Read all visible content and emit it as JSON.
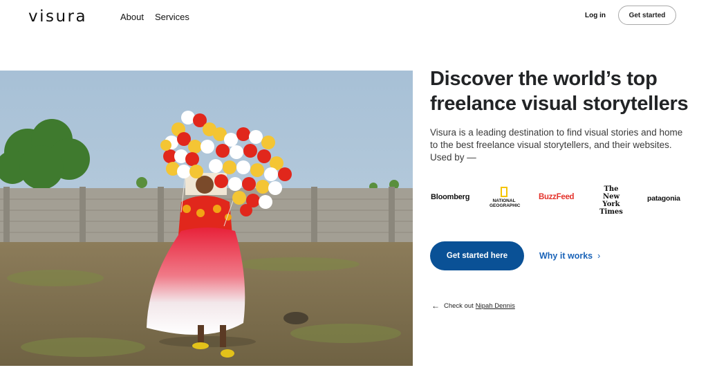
{
  "header": {
    "logo_text": "visura",
    "nav": [
      "About",
      "Services"
    ],
    "login_label": "Log in",
    "cta_label": "Get started"
  },
  "hero": {
    "headline_line1": "Discover the world’s top",
    "headline_line2": "freelance visual storytellers",
    "description": "Visura is a leading destination to find visual stories and home to the best freelance visual storytellers, and their websites. Used by —",
    "brands": {
      "bloomberg": "Bloomberg",
      "natgeo_line1": "NATIONAL",
      "natgeo_line2": "GEOGRAPHIC",
      "buzzfeed": "BuzzFeed",
      "nyt_line1": "The",
      "nyt_line2": "New York",
      "nyt_line3": "Times",
      "patagonia": "patagonia"
    },
    "primary_cta": "Get started here",
    "secondary_cta": "Why it works",
    "checkout_prefix": "Check out",
    "checkout_name": "Nipah Dennis"
  },
  "colors": {
    "primary": "#0a5196",
    "link": "#1a63b8",
    "buzzfeed": "#e4322b",
    "natgeo": "#f5c400"
  }
}
